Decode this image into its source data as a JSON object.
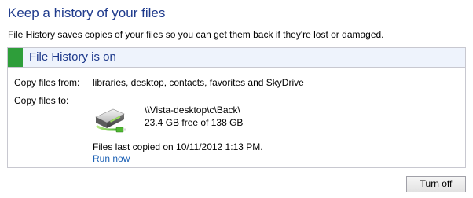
{
  "header": {
    "title": "Keep a history of your files",
    "description": "File History saves copies of your files so you can get them back if they're lost or damaged."
  },
  "status_panel": {
    "title": "File History is on",
    "status_color": "#2e9e3a",
    "copy_from_label": "Copy files from:",
    "copy_from_value": "libraries, desktop, contacts, favorites and SkyDrive",
    "copy_to_label": "Copy files to:",
    "drive_icon": "network-drive-icon",
    "drive_path": "\\\\Vista-desktop\\c\\Back\\",
    "drive_space": "23.4 GB free of 138 GB",
    "last_copied": "Files last copied on 10/11/2012 1:13 PM.",
    "run_now_label": "Run now"
  },
  "footer": {
    "turn_off_label": "Turn off"
  },
  "colors": {
    "heading": "#1e3a8c",
    "link": "#1a5fb4",
    "header_bg": "#eef3fc"
  }
}
